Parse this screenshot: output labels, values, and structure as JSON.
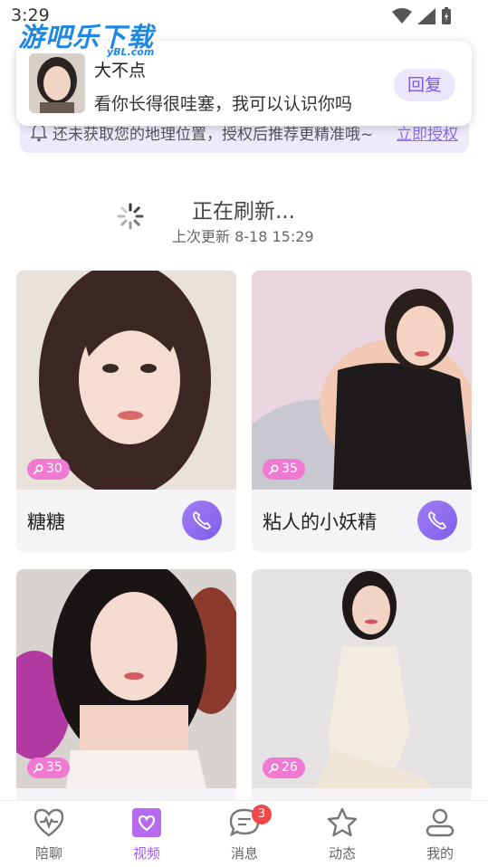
{
  "status_bar": {
    "time": "3:29"
  },
  "watermark": {
    "title": "游吧乐下载",
    "sub": "yBL.com"
  },
  "notification": {
    "name": "大不点",
    "message": "看你长得很哇塞，我可以认识你吗",
    "reply_label": "回复"
  },
  "location": {
    "text": "还未获取您的地理位置，授权后推荐更精准哦~",
    "action": "立即授权"
  },
  "refresh": {
    "title": "正在刷新...",
    "updated": "上次更新 8-18 15:29"
  },
  "cards": [
    {
      "name": "糖糖",
      "age": "30"
    },
    {
      "name": "粘人的小妖精",
      "age": "35"
    },
    {
      "name": "",
      "age": "35"
    },
    {
      "name": "",
      "age": "26"
    }
  ],
  "tabs": [
    {
      "label": "陪聊",
      "icon": "heart-pulse-icon"
    },
    {
      "label": "视频",
      "icon": "video-heart-icon"
    },
    {
      "label": "消息",
      "icon": "chat-icon"
    },
    {
      "label": "动态",
      "icon": "star-icon"
    },
    {
      "label": "我的",
      "icon": "user-icon"
    }
  ],
  "message_badge": "3",
  "colors": {
    "accent": "#a05ef0",
    "badge_pink": "#f07ad2",
    "call_purple": "#8c6cf0"
  }
}
